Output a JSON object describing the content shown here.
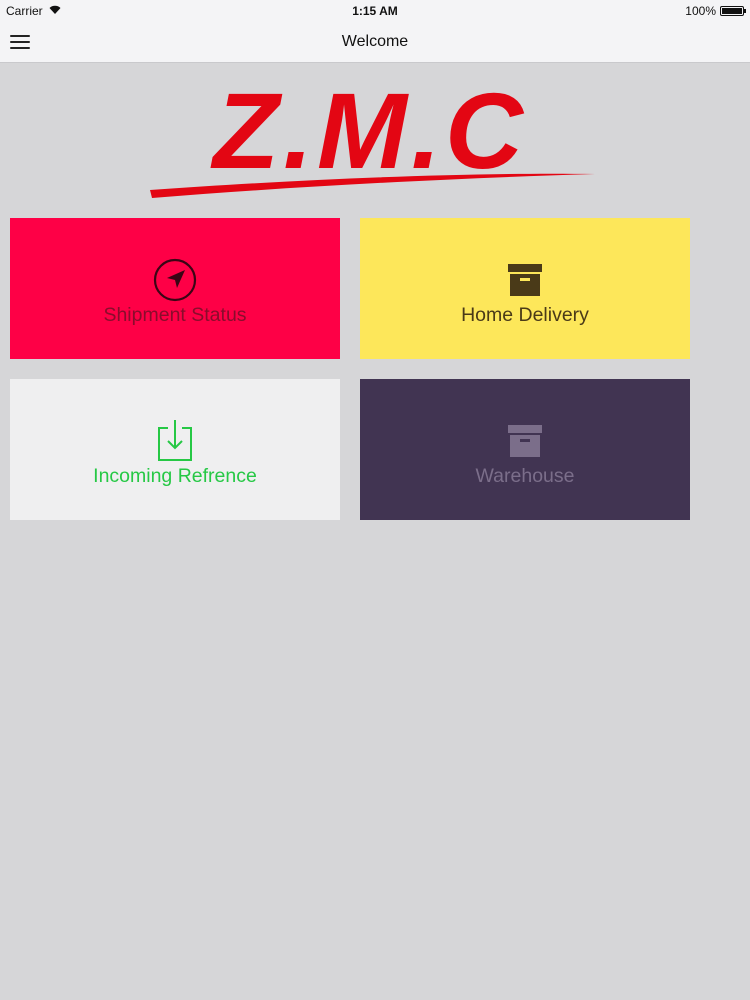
{
  "status_bar": {
    "carrier": "Carrier",
    "time": "1:15 AM",
    "battery": "100%"
  },
  "nav": {
    "title": "Welcome",
    "menu_icon": "hamburger-menu-icon"
  },
  "logo": {
    "text": "Z.M.C",
    "color": "#e30613"
  },
  "tiles": [
    {
      "label": "Shipment Status",
      "icon": "navigation-arrow-icon",
      "color": "#fe0046"
    },
    {
      "label": "Home Delivery",
      "icon": "archive-box-icon",
      "color": "#fde75a"
    },
    {
      "label": "Incoming Refrence",
      "icon": "download-tray-icon",
      "color": "#efeff0"
    },
    {
      "label": "Warehouse",
      "icon": "archive-box-icon",
      "color": "#413452"
    }
  ]
}
